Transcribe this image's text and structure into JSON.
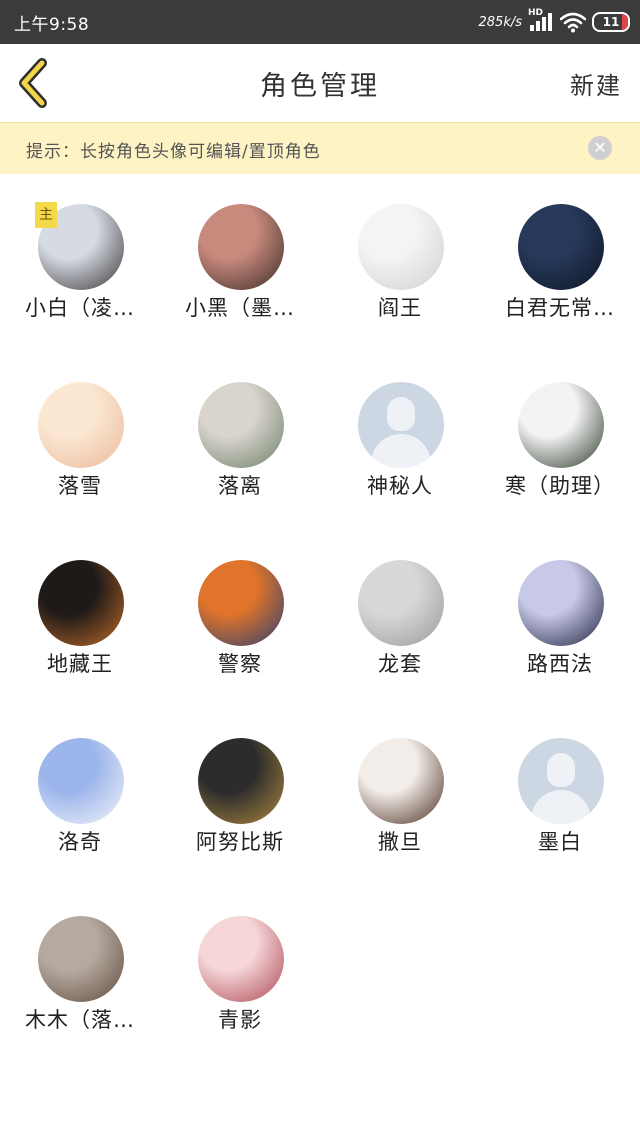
{
  "status_bar": {
    "time": "上午9:58",
    "net_speed": "285k/s",
    "network_type": "HD",
    "battery": "11",
    "icons": [
      "signal-icon",
      "wifi-icon",
      "battery-icon"
    ]
  },
  "nav": {
    "back_icon": "chevron-left-icon",
    "title": "角色管理",
    "new_label": "新建"
  },
  "tip": {
    "text": "提示：长按角色头像可编辑/置顶角色",
    "close_icon": "close-icon"
  },
  "colors": {
    "accent": "#f4d94a",
    "tip_background": "#fdf3c5",
    "status_bar": "#3b3b3b"
  },
  "roles": [
    {
      "name": "小白（凌…",
      "badge": "主",
      "avatar": "anime-character-white-black-hair",
      "color_a": "#d6dbe3",
      "color_b": "#3a3538"
    },
    {
      "name": "小黑（墨…",
      "avatar": "anime-character-split-hair",
      "color_a": "#c98a7e",
      "color_b": "#3a2b25"
    },
    {
      "name": "阎王",
      "avatar": "fluffy-white-animal",
      "color_a": "#f4f4f4",
      "color_b": "#cfcfcf"
    },
    {
      "name": "白君无常…",
      "avatar": "dark-blue-night-figure",
      "color_a": "#27395a",
      "color_b": "#0d1524"
    },
    {
      "name": "落雪",
      "avatar": "illustrated-white-cat",
      "color_a": "#fbe7d2",
      "color_b": "#e9b99a"
    },
    {
      "name": "落离",
      "avatar": "white-cat-blue-eyes",
      "color_a": "#d9d4cc",
      "color_b": "#6b7f6a"
    },
    {
      "name": "神秘人",
      "avatar": "default-person-placeholder",
      "placeholder": true
    },
    {
      "name": "寒（助理）",
      "avatar": "white-ferret",
      "color_a": "#f3f3f3",
      "color_b": "#2c3a2c"
    },
    {
      "name": "地藏王",
      "avatar": "calico-cat",
      "color_a": "#1e1a18",
      "color_b": "#c06b2a"
    },
    {
      "name": "警察",
      "avatar": "fire-poster-figure",
      "color_a": "#e0742a",
      "color_b": "#2b3f72"
    },
    {
      "name": "龙套",
      "avatar": "pencil-sketch-figures",
      "color_a": "#d8d8d8",
      "color_b": "#9a9a9a"
    },
    {
      "name": "路西法",
      "avatar": "witch-hat-character",
      "color_a": "#c7c9e6",
      "color_b": "#1f2240"
    },
    {
      "name": "洛奇",
      "avatar": "blue-floral-pattern",
      "color_a": "#9cb5ea",
      "color_b": "#f4f6fb"
    },
    {
      "name": "阿努比斯",
      "avatar": "armored-warrior-statue",
      "color_a": "#2c2c2c",
      "color_b": "#b08a3e"
    },
    {
      "name": "撒旦",
      "avatar": "coffee-beans-cups",
      "color_a": "#f2ede8",
      "color_b": "#4a2e22"
    },
    {
      "name": "墨白",
      "avatar": "default-person-placeholder",
      "placeholder": true
    },
    {
      "name": "木木（落…",
      "avatar": "coffee-shop-counter",
      "color_a": "#b6aaa0",
      "color_b": "#5f4b3e"
    },
    {
      "name": "青影",
      "avatar": "pink-dream-portrait",
      "color_a": "#f6d6d8",
      "color_b": "#a94752"
    }
  ]
}
